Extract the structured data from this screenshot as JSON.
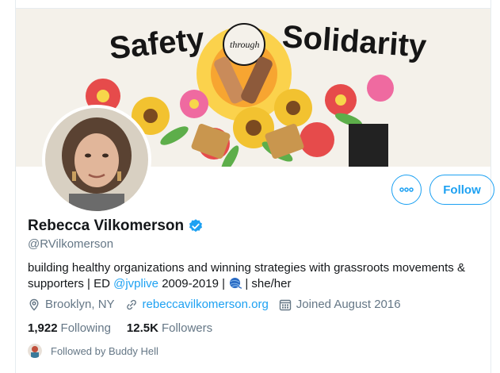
{
  "banner": {
    "text_left": "Safety",
    "text_through": "through",
    "text_right": "Solidarity"
  },
  "actions": {
    "follow_label": "Follow"
  },
  "profile": {
    "name": "Rebecca Vilkomerson",
    "handle": "@RVilkomerson",
    "bio_part1": "building healthy organizations and winning strategies with grassroots movements & supporters | ED ",
    "bio_mention": "@jvplive",
    "bio_part2": " 2009-2019 | ",
    "bio_part3": " | she/her",
    "location": "Brooklyn, NY",
    "website": "rebeccavilkomerson.org",
    "joined": "Joined August 2016"
  },
  "stats": {
    "following_count": "1,922",
    "following_label": "Following",
    "followers_count": "12.5K",
    "followers_label": "Followers"
  },
  "social_context": {
    "text": "Followed by Buddy Hell"
  },
  "colors": {
    "accent": "#1da1f2",
    "secondary_text": "#657786"
  }
}
